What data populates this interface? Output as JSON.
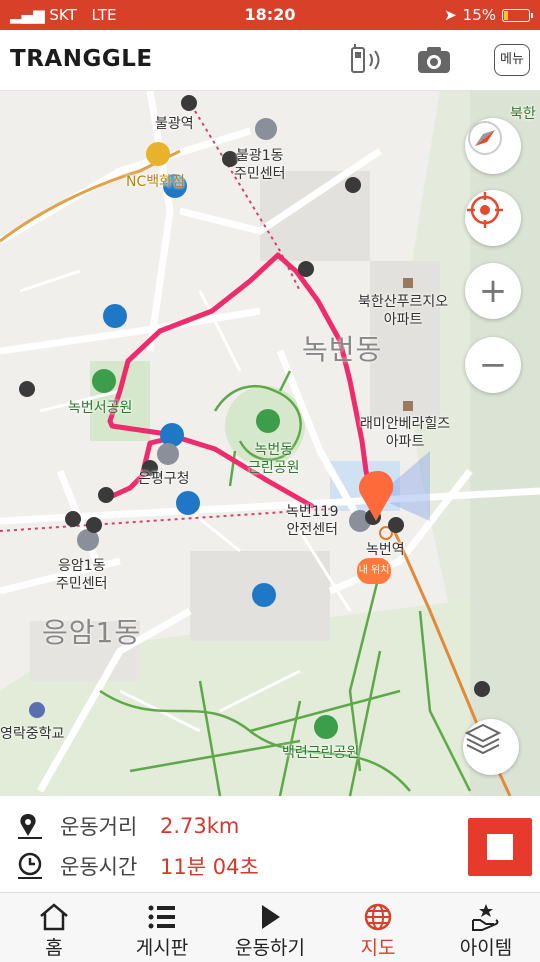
{
  "status_bar": {
    "carrier": "SKT",
    "network": "LTE",
    "time": "18:20",
    "battery": "15%",
    "battery_level": 0.15
  },
  "app": {
    "logo": "TRANGGLE",
    "menu_label": "메뉴",
    "icons": [
      "walkie-icon",
      "camera-icon"
    ]
  },
  "map": {
    "places": {
      "bulgwang_station": "불광역",
      "bulgwang1_center": "불광1동\n주민센터",
      "nc": "NC백화점",
      "bukhan_top": "북한",
      "bukhansan_apt": "북한산푸르지오\n아파트",
      "nokbeon_dong": "녹번동",
      "nokbeon_park": "녹번서공원",
      "raemian": "래미안베라힐즈\n아파트",
      "nokbeon_geunrin": "녹번동\n근린공원",
      "eunpyeong_office": "은평구청",
      "nokbeon119": "녹번119\n안전센터",
      "nokbeon_station": "녹번역",
      "eungam1_center": "응암1동\n주민센터",
      "eungam1": "응암1동",
      "yeongrak_school": "영락중학교",
      "baekryeon_park": "백련근린공원",
      "my_location": "내 위치"
    },
    "controls": [
      "compass-icon",
      "locate-icon",
      "zoom-in-icon",
      "zoom-out-icon",
      "layers-icon"
    ],
    "route_color": "#ee2b6c"
  },
  "stats": {
    "distance_label": "운동거리",
    "distance_value": "2.73km",
    "time_label": "운동시간",
    "time_value": "11분 04초"
  },
  "tabs": [
    {
      "label": "홈",
      "icon": "home-icon"
    },
    {
      "label": "게시판",
      "icon": "list-icon"
    },
    {
      "label": "운동하기",
      "icon": "play-icon"
    },
    {
      "label": "지도",
      "icon": "globe-icon",
      "active": true
    },
    {
      "label": "아이템",
      "icon": "gift-icon"
    }
  ]
}
